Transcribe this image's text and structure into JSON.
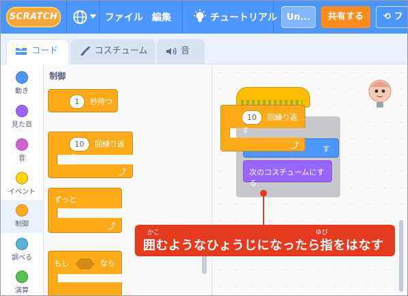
{
  "menubar": {
    "logo": "SCRATCH",
    "file": "ファイル",
    "edit": "編集",
    "tutorials": "チュートリアル",
    "project_title": "Un...",
    "share": "共有する",
    "remix": "フ"
  },
  "tabs": {
    "code": "コード",
    "costumes": "コスチューム",
    "sounds": "音"
  },
  "categories": [
    {
      "label": "動き",
      "color": "#4c97ff"
    },
    {
      "label": "見た目",
      "color": "#9966ff"
    },
    {
      "label": "音",
      "color": "#cf63cf"
    },
    {
      "label": "イベント",
      "color": "#ffd500"
    },
    {
      "label": "制御",
      "color": "#ffab19"
    },
    {
      "label": "調べる",
      "color": "#5cb1d6"
    },
    {
      "label": "演算",
      "color": "#59c059"
    }
  ],
  "palette": {
    "heading": "制御",
    "wait": {
      "value": "1",
      "text": "秒待つ"
    },
    "repeat": {
      "value": "10",
      "text": "回繰り返す"
    },
    "forever": "ずっと",
    "if_prefix": "もし",
    "if_suffix": "なら"
  },
  "workspace": {
    "drag_repeat": {
      "value": "10",
      "text": "回繰り返す"
    },
    "hidden_fragment": "す",
    "next_costume": "次のコスチュームにする"
  },
  "callout": {
    "text": "囲むようなひょうじになったら指をはなす",
    "ruby_kako": "かこ",
    "ruby_yubi": "ゆび"
  },
  "colors": {
    "menubar": "#4c97ff",
    "control": "#ffab19",
    "looks": "#9966ff",
    "callout": "#e53a1e",
    "share": "#ff8c1a"
  }
}
